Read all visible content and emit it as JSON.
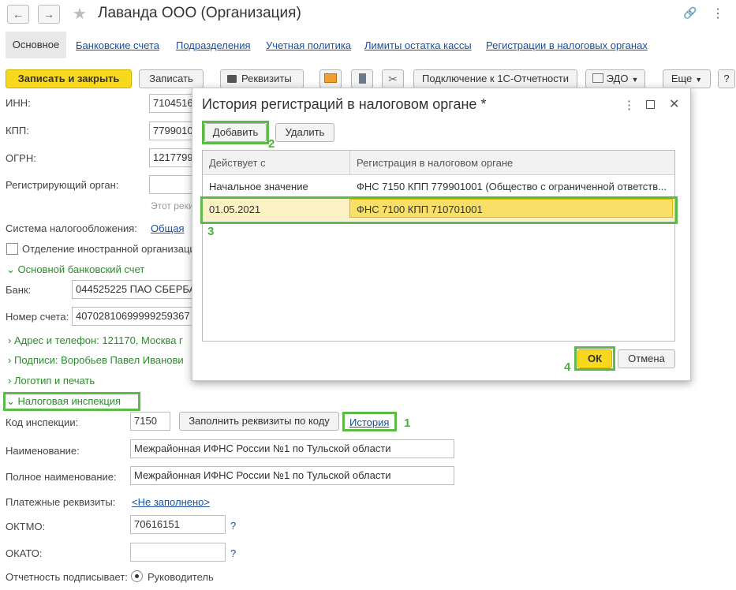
{
  "window": {
    "title": "Лаванда ООО (Организация)",
    "nav_back": "←",
    "nav_forward": "→",
    "star": "★",
    "link_icon": "🔗",
    "more_icon": "⋮"
  },
  "tabs": [
    {
      "label": "Основное"
    },
    {
      "label": "Банковские счета"
    },
    {
      "label": "Подразделения"
    },
    {
      "label": "Учетная политика"
    },
    {
      "label": "Лимиты остатка кассы"
    },
    {
      "label": "Регистрации в налоговых органах"
    }
  ],
  "toolbar": {
    "save_close": "Записать и закрыть",
    "save": "Записать",
    "requisites": "Реквизиты",
    "connect": "Подключение к 1С-Отчетности",
    "edo": "ЭДО",
    "more": "Еще",
    "help": "?"
  },
  "form": {
    "inn_label": "ИНН:",
    "inn_value": "7104516",
    "kpp_label": "КПП:",
    "kpp_value": "7799010",
    "ogrn_label": "ОГРН:",
    "ogrn_value": "1217799",
    "reg_organ_label": "Регистрирующий орган:",
    "reg_hint": "Этот реки",
    "tax_system_label": "Система налогообложения:",
    "tax_system_value": "Общая",
    "foreign_branch": "Отделение иностранной организаци",
    "bank_section": "Основной банковский счет",
    "bank_label": "Банк:",
    "bank_value": "044525225 ПАО СБЕРБА",
    "account_label": "Номер счета:",
    "account_value": "40702810699999259367",
    "address": "Адрес и телефон: 121170, Москва г",
    "signatures": "Подписи: Воробьев Павел Иванови",
    "logo": "Логотип и печать",
    "tax_inspection": "Налоговая инспекция",
    "inspection_code_label": "Код инспекции:",
    "inspection_code_value": "7150",
    "fill_by_code": "Заполнить реквизиты по коду",
    "history": "История",
    "name_label": "Наименование:",
    "name_value": "Межрайонная ИФНС России №1 по Тульской области",
    "full_name_label": "Полное наименование:",
    "full_name_value": "Межрайонная ИФНС России №1 по Тульской области",
    "payment_label": "Платежные реквизиты:",
    "payment_value": "<Не заполнено>",
    "oktmo_label": "ОКТМО:",
    "oktmo_value": "70616151",
    "okato_label": "ОКАТО:",
    "okato_value": "",
    "report_signs_label": "Отчетность подписывает:",
    "report_signs_value": "Руководитель",
    "q": "?"
  },
  "dialog": {
    "title": "История регистраций в налоговом органе *",
    "add": "Добавить",
    "delete": "Удалить",
    "col1": "Действует с",
    "col2": "Регистрация в налоговом органе",
    "rows": [
      {
        "date": "Начальное значение",
        "reg": "ФНС 7150 КПП 779901001 (Общество с ограниченной ответств..."
      },
      {
        "date": "01.05.2021",
        "reg": "ФНС 7100 КПП 710701001"
      }
    ],
    "ok": "ОК",
    "cancel": "Отмена"
  },
  "markers": {
    "m1": "1",
    "m2": "2",
    "m3": "3",
    "m4": "4"
  }
}
